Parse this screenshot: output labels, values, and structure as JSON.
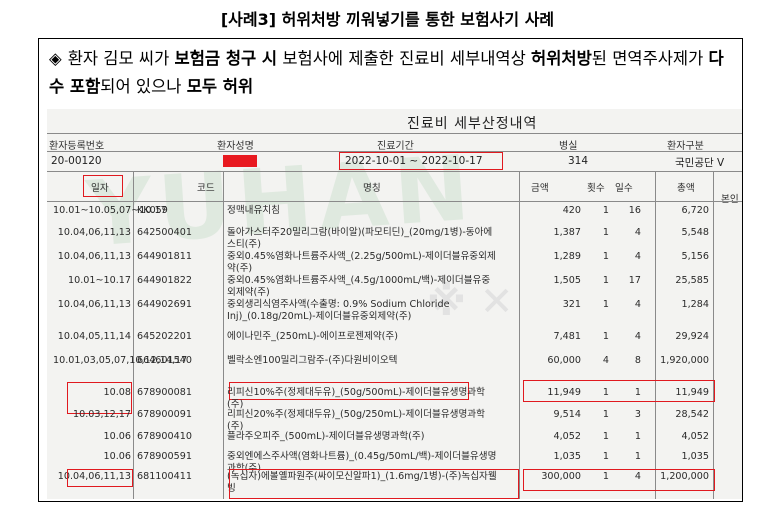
{
  "heading": "[사례3] 허위처방 끼워넣기를 통한 보험사기 사례",
  "bullet": {
    "marker": "◈",
    "t1": "환자 김모 씨가 ",
    "b1": "보험금 청구 시",
    "t2": " 보험사에 제출한 진료비 세부내역상 ",
    "b2": "허위처방",
    "t3": "된 면역주사제가 ",
    "b3": "다수 포함",
    "t4": "되어 있으나 ",
    "b4": "모두 허위"
  },
  "doc": {
    "title": "진료비 세부산정내역",
    "headers": [
      "환자등록번호",
      "환자성명",
      "진료기간",
      "병실",
      "환자구분"
    ],
    "values": {
      "reg_no": "20-00120",
      "period": "2022-10-01 ~ 2022-10-17",
      "room": "314",
      "type": "국민공단 V"
    },
    "columns": [
      "일자",
      "코드",
      "명칭",
      "금액",
      "횟수",
      "일수",
      "총액",
      "본인"
    ],
    "rows": [
      {
        "date": "10.01~10.05,07~10.17",
        "code": "KK059",
        "name": "정맥내유치침",
        "price": "420",
        "count": "1",
        "days": "16",
        "total": "6,720"
      },
      {
        "date": "10.04,06,11,13",
        "code": "642500401",
        "name": "돌아가스터주20밀리그람(바이알)(파모티딘)_(20mg/1병)-동아에스티(주)",
        "price": "1,387",
        "count": "1",
        "days": "4",
        "total": "5,548"
      },
      {
        "date": "10.04,06,11,13",
        "code": "644901811",
        "name": "중외0.45%염화나트륨주사액_(2.25g/500mL)-제이더블유중외제약(주)",
        "price": "1,289",
        "count": "1",
        "days": "4",
        "total": "5,156"
      },
      {
        "date": "10.01~10.17",
        "code": "644901822",
        "name": "중외0.45%염화나트륨주사액_(4.5g/1000mL/백)-제이더블유중외제약(주)",
        "price": "1,505",
        "count": "1",
        "days": "17",
        "total": "25,585"
      },
      {
        "date": "10.04,06,11,13",
        "code": "644902691",
        "name": "중외생리식염주사액(수출명: 0.9% Sodium Chloride Inj)_(0.18g/20mL)-제이더블유중외제약(주)",
        "price": "321",
        "count": "1",
        "days": "4",
        "total": "1,284"
      },
      {
        "date": "10.04,05,11,14",
        "code": "645202201",
        "name": "에이나민주_(250mL)-에이프로젠제약(주)",
        "price": "7,481",
        "count": "1",
        "days": "4",
        "total": "29,924"
      },
      {
        "date": "10.01,03,05,07,10,12,14,17",
        "code": "664601540",
        "name": "벨락소엔100밀리그람주-(주)다원비이오텍",
        "price": "60,000",
        "count": "4",
        "days": "8",
        "total": "1,920,000"
      },
      {
        "date": "10.08",
        "code": "678900081",
        "name": "리피신10%주(정제대두유)_(50g/500mL)-제이더블유생명과학(주)",
        "price": "11,949",
        "count": "1",
        "days": "1",
        "total": "11,949"
      },
      {
        "date": "10.03,12,17",
        "code": "678900091",
        "name": "리피신20%주(정제대두유)_(50g/250mL)-제이더블유생명과학(주)",
        "price": "9,514",
        "count": "1",
        "days": "3",
        "total": "28,542"
      },
      {
        "date": "10.06",
        "code": "678900410",
        "name": "플라주오피주_(500mL)-제이더블유생명과학(주)",
        "price": "4,052",
        "count": "1",
        "days": "1",
        "total": "4,052"
      },
      {
        "date": "10.06",
        "code": "678900591",
        "name": "중외엔에스주사액(염화나트륨)_(0.45g/50mL/백)-제이더블유생명과학(주)",
        "price": "1,035",
        "count": "1",
        "days": "1",
        "total": "1,035"
      },
      {
        "date": "10.04,06,11,13",
        "code": "681100411",
        "name": "(녹십자)에볼옐파원주(싸이모신알파1)_(1.6mg/1병)-(주)녹십자웰빙",
        "price": "300,000",
        "count": "1",
        "days": "4",
        "total": "1,200,000"
      }
    ]
  },
  "colors": {
    "highlight": "#e0191f"
  }
}
